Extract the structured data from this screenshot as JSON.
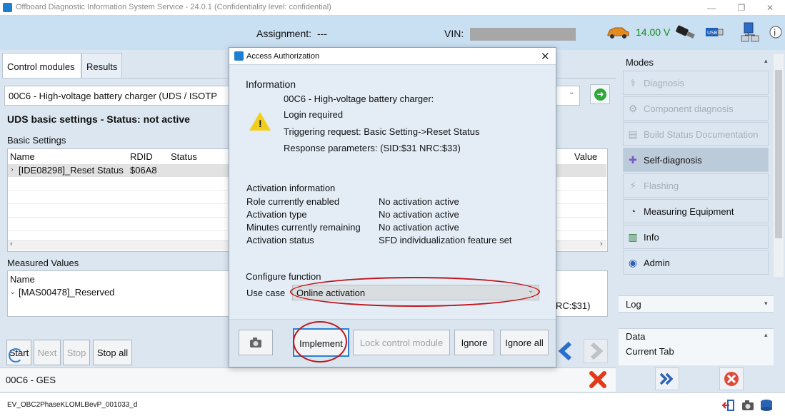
{
  "window": {
    "title": "Offboard Diagnostic Information System Service - 24.0.1 (Confidentiality level: confidential)",
    "buttons": [
      "—",
      "❐",
      "✕"
    ]
  },
  "header": {
    "assignment_label": "Assignment:",
    "assignment_value": "---",
    "vin_label": "VIN:",
    "voltage": "14.00 V"
  },
  "tabs": [
    {
      "label": "Control modules"
    },
    {
      "label": "Results"
    }
  ],
  "module_select": {
    "value": "00C6 - High-voltage battery charger  (UDS / ISOTP"
  },
  "status_line": "UDS basic settings - Status: not active",
  "basic_settings": {
    "label": "Basic Settings",
    "columns": [
      "Name",
      "RDID",
      "Status",
      "Value"
    ],
    "row": {
      "name": "[IDE08298]_Reset Status",
      "rdid": "$06A8"
    }
  },
  "measured_values": {
    "label": "Measured Values",
    "name_header": "Name",
    "row": "[MAS00478]_Reserved",
    "nrc_fragment": "RC:$31)"
  },
  "buttons_left": {
    "start": "Start",
    "next": "Next",
    "stop": "Stop",
    "stop_all": "Stop all"
  },
  "statusbar": {
    "module": "00C6 - GES"
  },
  "modes": {
    "title": "Modes",
    "items": [
      {
        "label": "Diagnosis",
        "icon": "stethoscope-icon",
        "state": "disabled"
      },
      {
        "label": "Component diagnosis",
        "icon": "gear-icon",
        "state": "disabled"
      },
      {
        "label": "Build Status Documentation",
        "icon": "document-icon",
        "state": "disabled"
      },
      {
        "label": "Self-diagnosis",
        "icon": "self-diagnosis-icon",
        "state": "active"
      },
      {
        "label": "Flashing",
        "icon": "flash-icon",
        "state": "disabled"
      },
      {
        "label": "Measuring Equipment",
        "icon": "gauge-icon",
        "state": "normal"
      },
      {
        "label": "Info",
        "icon": "books-icon",
        "state": "normal"
      },
      {
        "label": "Admin",
        "icon": "admin-icon",
        "state": "normal"
      }
    ]
  },
  "log": {
    "title": "Log"
  },
  "data_panel": {
    "title": "Data",
    "current_tab": "Current Tab"
  },
  "footer": {
    "filename": "EV_OBC2PhaseKLOMLBevP_001033_d"
  },
  "dialog": {
    "title": "Access Authorization",
    "information_label": "Information",
    "info_lines": [
      "00C6 - High-voltage battery charger:",
      "Login required",
      "Triggering request: Basic Setting->Reset Status",
      "Response parameters: (SID:$31 NRC:$33)"
    ],
    "activation_label": "Activation information",
    "activation_rows": [
      {
        "key": "Role currently enabled",
        "value": "No activation active"
      },
      {
        "key": "Activation type",
        "value": "No activation active"
      },
      {
        "key": "Minutes currently remaining",
        "value": "No activation active"
      },
      {
        "key": "Activation status",
        "value": "SFD individualization feature set"
      }
    ],
    "configure_label": "Configure function",
    "usecase_label": "Use case",
    "usecase_value": "Online activation",
    "buttons": {
      "implement": "Implement",
      "lock": "Lock control module",
      "ignore": "Ignore",
      "ignore_all": "Ignore all"
    }
  },
  "colors": {
    "annotation_red": "#c0151a",
    "voltage_green": "#138a1e",
    "accent_blue": "#1e7fd0"
  }
}
